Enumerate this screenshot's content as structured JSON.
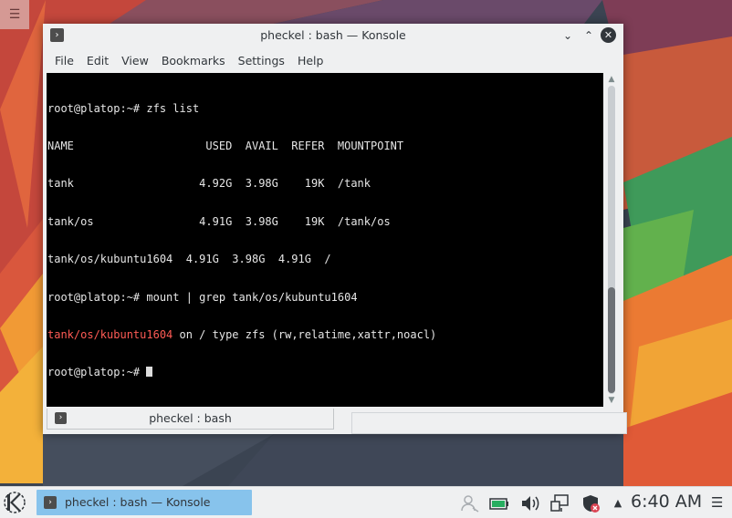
{
  "window": {
    "title": "pheckel : bash — Konsole",
    "controls": {
      "minimize": "⌄",
      "maximize": "⌃",
      "close": "✕"
    }
  },
  "menubar": [
    "File",
    "Edit",
    "View",
    "Bookmarks",
    "Settings",
    "Help"
  ],
  "terminal": {
    "lines": [
      "root@platop:~# zfs list",
      "NAME                    USED  AVAIL  REFER  MOUNTPOINT",
      "tank                   4.92G  3.98G    19K  /tank",
      "tank/os                4.91G  3.98G    19K  /tank/os",
      "tank/os/kubuntu1604  4.91G  3.98G  4.91G  /",
      "root@platop:~# mount | grep tank/os/kubuntu1604"
    ],
    "mount_result": {
      "dataset": "tank/os/kubuntu1604",
      "rest": " on / type zfs (rw,relatime,xattr,noacl)"
    },
    "prompt": "root@platop:~# "
  },
  "tab": {
    "label": "pheckel : bash"
  },
  "taskbar": {
    "task_label": "pheckel : bash — Konsole",
    "clock": "6:40 AM"
  },
  "icons": [
    "desktop-menu-icon",
    "konsole-icon",
    "kde-launcher-icon",
    "user-icon",
    "battery-icon",
    "volume-icon",
    "network-icon",
    "firewall-icon",
    "expand-tray-icon",
    "hamburger-icon"
  ],
  "colors": {
    "accent": "#87c3ec",
    "terminal_bg": "#000000",
    "highlight_text": "#ff5b55"
  }
}
